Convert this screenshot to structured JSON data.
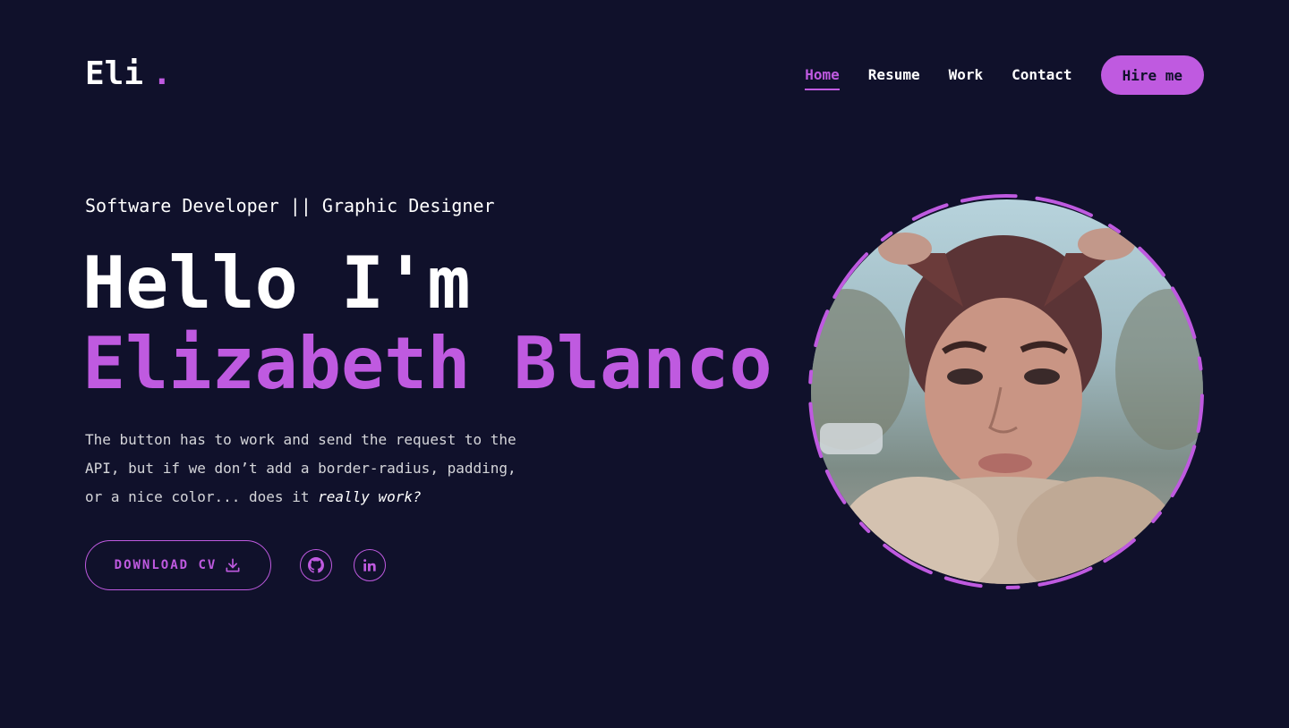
{
  "logo": {
    "text": "Eli",
    "dot": "."
  },
  "nav": {
    "links": [
      "Home",
      "Resume",
      "Work",
      "Contact"
    ],
    "active": "Home",
    "hire_label": "Hire me"
  },
  "hero": {
    "subtitle": "Software Developer || Graphic Designer",
    "greeting": "Hello I'm",
    "name": "Elizabeth Blanco",
    "description": "The button has to work and send the request to the API, but if we don’t add a border-radius, padding, or a nice color... does it ",
    "description_emphasis": "really work?",
    "download_label": "DOWNLOAD CV",
    "socials": [
      "github-icon",
      "linkedin-icon"
    ]
  },
  "photo": {
    "alt": "portrait"
  },
  "colors": {
    "background": "#10112b",
    "accent": "#bf5ae0",
    "text": "#ffffff"
  }
}
